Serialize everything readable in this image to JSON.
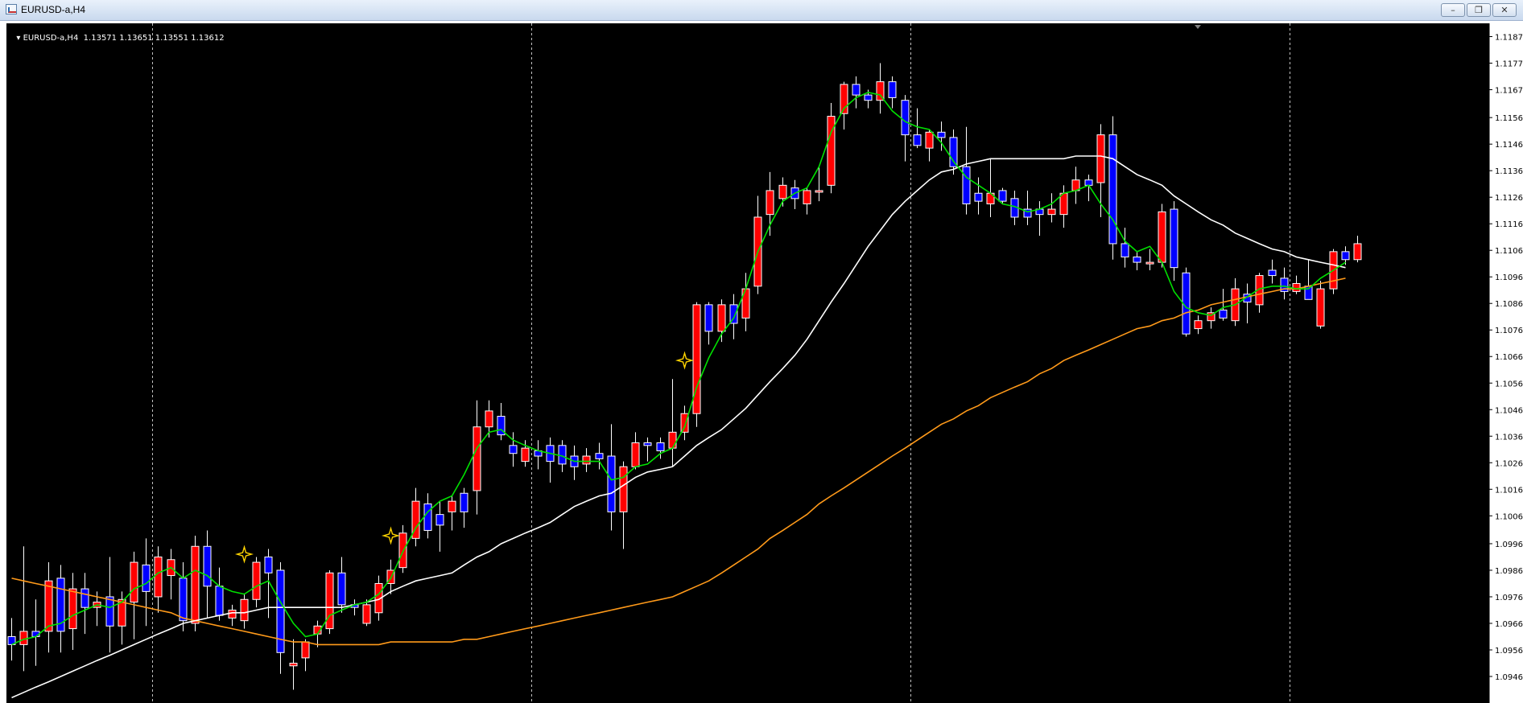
{
  "window": {
    "title": "EURUSD-a,H4",
    "minimize_icon": "minimize-icon",
    "restore_icon": "restore-icon",
    "close_icon": "close-icon"
  },
  "symbol_line": {
    "symbol": "EURUSD-a,H4",
    "ohlc": "1.13571 1.13651 1.13551 1.13612"
  },
  "colors": {
    "background": "#000000",
    "bull": "#ff0000",
    "bear": "#0000ff",
    "ma_fast": "#00e000",
    "ma_mid": "#ffffff",
    "ma_slow": "#ff9a1a",
    "fractal": "#ffd400",
    "grid": "#c0c0c0"
  },
  "chart_data": {
    "type": "candlestick",
    "ylim": [
      1.0936,
      1.1192
    ],
    "yticks": [
      "1.11870",
      "1.11770",
      "1.11670",
      "1.11565",
      "1.11465",
      "1.11365",
      "1.11265",
      "1.11165",
      "1.11065",
      "1.10965",
      "1.10865",
      "1.10765",
      "1.10665",
      "1.10565",
      "1.10465",
      "1.10365",
      "1.10265",
      "1.10165",
      "1.10065",
      "1.09960",
      "1.09860",
      "1.09760",
      "1.09660",
      "1.09560",
      "1.09460"
    ],
    "candles": [
      [
        1.0961,
        1.0968,
        1.0952,
        1.0958
      ],
      [
        1.0958,
        1.0995,
        1.0948,
        1.0963
      ],
      [
        1.0963,
        1.0975,
        1.095,
        1.0961
      ],
      [
        1.0963,
        1.0989,
        1.0955,
        1.0982
      ],
      [
        1.0983,
        1.0988,
        1.0955,
        1.0963
      ],
      [
        1.0964,
        1.0985,
        1.0956,
        1.0979
      ],
      [
        1.0979,
        1.0985,
        1.0962,
        1.0972
      ],
      [
        1.0972,
        1.0978,
        1.0965,
        1.0974
      ],
      [
        1.0976,
        1.0991,
        1.0955,
        1.0965
      ],
      [
        1.0965,
        1.0978,
        1.0958,
        1.0975
      ],
      [
        1.0974,
        1.0993,
        1.096,
        1.0989
      ],
      [
        1.0988,
        1.0998,
        1.0965,
        1.0978
      ],
      [
        1.0976,
        1.0995,
        1.097,
        1.0991
      ],
      [
        1.0984,
        1.0994,
        1.0975,
        1.099
      ],
      [
        1.0983,
        1.0989,
        1.0963,
        1.0967
      ],
      [
        1.0966,
        1.0999,
        1.0963,
        1.0995
      ],
      [
        1.0995,
        1.1001,
        1.0968,
        1.098
      ],
      [
        1.098,
        1.0987,
        1.0967,
        1.0969
      ],
      [
        1.0968,
        1.0973,
        1.0965,
        1.0971
      ],
      [
        1.0967,
        1.0977,
        1.0964,
        1.0975
      ],
      [
        1.0975,
        1.0991,
        1.0972,
        1.0989
      ],
      [
        1.0991,
        1.0994,
        1.0968,
        1.0985
      ],
      [
        1.0986,
        1.0989,
        1.0947,
        1.0955
      ],
      [
        1.095,
        1.096,
        1.0941,
        1.0951
      ],
      [
        1.0953,
        1.096,
        1.0948,
        1.0959
      ],
      [
        1.0962,
        1.0967,
        1.0957,
        1.0965
      ],
      [
        1.0964,
        1.0986,
        1.0962,
        1.0985
      ],
      [
        1.0985,
        1.0991,
        1.097,
        1.0973
      ],
      [
        1.0973,
        1.0975,
        1.0969,
        1.0972
      ],
      [
        1.0966,
        1.0975,
        1.0965,
        1.0973
      ],
      [
        1.097,
        1.0984,
        1.0967,
        1.0981
      ],
      [
        1.0981,
        1.099,
        1.0977,
        1.0986
      ],
      [
        1.0987,
        1.1003,
        1.0985,
        1.1
      ],
      [
        1.0998,
        1.1017,
        1.0995,
        1.1012
      ],
      [
        1.1011,
        1.1015,
        1.0998,
        1.1001
      ],
      [
        1.1007,
        1.1012,
        1.0993,
        1.1003
      ],
      [
        1.1008,
        1.1014,
        1.1001,
        1.1012
      ],
      [
        1.1015,
        1.1017,
        1.1002,
        1.1008
      ],
      [
        1.1016,
        1.105,
        1.1007,
        1.104
      ],
      [
        1.104,
        1.105,
        1.1036,
        1.1046
      ],
      [
        1.1044,
        1.1049,
        1.1035,
        1.1037
      ],
      [
        1.1033,
        1.1038,
        1.1025,
        1.103
      ],
      [
        1.1027,
        1.1035,
        1.1025,
        1.1032
      ],
      [
        1.1031,
        1.1035,
        1.1024,
        1.1029
      ],
      [
        1.1033,
        1.1036,
        1.1019,
        1.1027
      ],
      [
        1.1033,
        1.1035,
        1.1023,
        1.1026
      ],
      [
        1.1029,
        1.1033,
        1.102,
        1.1025
      ],
      [
        1.1026,
        1.1032,
        1.1023,
        1.1029
      ],
      [
        1.103,
        1.1034,
        1.1024,
        1.1028
      ],
      [
        1.1029,
        1.1041,
        1.1001,
        1.1008
      ],
      [
        1.1008,
        1.1027,
        1.0994,
        1.1025
      ],
      [
        1.1025,
        1.1038,
        1.1024,
        1.1034
      ],
      [
        1.1034,
        1.1036,
        1.1027,
        1.1033
      ],
      [
        1.1034,
        1.1036,
        1.1028,
        1.1031
      ],
      [
        1.1032,
        1.1058,
        1.1025,
        1.1038
      ],
      [
        1.1038,
        1.1048,
        1.1035,
        1.1045
      ],
      [
        1.1045,
        1.1087,
        1.104,
        1.1086
      ],
      [
        1.1086,
        1.1087,
        1.1071,
        1.1076
      ],
      [
        1.1076,
        1.1088,
        1.1072,
        1.1086
      ],
      [
        1.1086,
        1.109,
        1.1073,
        1.1079
      ],
      [
        1.1081,
        1.1098,
        1.1076,
        1.1092
      ],
      [
        1.1093,
        1.1127,
        1.109,
        1.1119
      ],
      [
        1.112,
        1.1136,
        1.1112,
        1.1129
      ],
      [
        1.1126,
        1.1134,
        1.1123,
        1.1131
      ],
      [
        1.113,
        1.1133,
        1.1122,
        1.1126
      ],
      [
        1.1124,
        1.113,
        1.112,
        1.1129
      ],
      [
        1.1129,
        1.1138,
        1.1125,
        1.1129
      ],
      [
        1.1131,
        1.1162,
        1.1128,
        1.1157
      ],
      [
        1.1158,
        1.117,
        1.1152,
        1.1169
      ],
      [
        1.1169,
        1.1172,
        1.116,
        1.1165
      ],
      [
        1.1165,
        1.1167,
        1.116,
        1.1163
      ],
      [
        1.1163,
        1.1177,
        1.1158,
        1.117
      ],
      [
        1.117,
        1.1172,
        1.116,
        1.1164
      ],
      [
        1.1163,
        1.1165,
        1.114,
        1.115
      ],
      [
        1.115,
        1.116,
        1.1145,
        1.1146
      ],
      [
        1.1145,
        1.1152,
        1.114,
        1.1151
      ],
      [
        1.1151,
        1.1155,
        1.1144,
        1.1149
      ],
      [
        1.1149,
        1.1152,
        1.1135,
        1.1138
      ],
      [
        1.1138,
        1.1153,
        1.112,
        1.1124
      ],
      [
        1.1128,
        1.1134,
        1.112,
        1.1125
      ],
      [
        1.1124,
        1.1141,
        1.1119,
        1.1128
      ],
      [
        1.1129,
        1.113,
        1.1124,
        1.1125
      ],
      [
        1.1126,
        1.1129,
        1.1116,
        1.1119
      ],
      [
        1.1122,
        1.1129,
        1.1116,
        1.1119
      ],
      [
        1.1122,
        1.1125,
        1.1112,
        1.112
      ],
      [
        1.112,
        1.1128,
        1.1117,
        1.1122
      ],
      [
        1.112,
        1.1131,
        1.1115,
        1.1128
      ],
      [
        1.1129,
        1.1138,
        1.1124,
        1.1133
      ],
      [
        1.1133,
        1.1135,
        1.1125,
        1.1131
      ],
      [
        1.1132,
        1.1154,
        1.1119,
        1.115
      ],
      [
        1.115,
        1.1157,
        1.1103,
        1.1109
      ],
      [
        1.1109,
        1.1115,
        1.11,
        1.1104
      ],
      [
        1.1104,
        1.1106,
        1.1099,
        1.1102
      ],
      [
        1.1102,
        1.1107,
        1.1099,
        1.1102
      ],
      [
        1.1102,
        1.1124,
        1.11,
        1.1121
      ],
      [
        1.1122,
        1.1125,
        1.1095,
        1.11
      ],
      [
        1.1098,
        1.11,
        1.1074,
        1.1075
      ],
      [
        1.1077,
        1.1082,
        1.1075,
        1.108
      ],
      [
        1.108,
        1.1085,
        1.1077,
        1.1083
      ],
      [
        1.1084,
        1.1092,
        1.108,
        1.1081
      ],
      [
        1.108,
        1.1096,
        1.1078,
        1.1092
      ],
      [
        1.109,
        1.1094,
        1.1079,
        1.1087
      ],
      [
        1.1086,
        1.1098,
        1.1083,
        1.1097
      ],
      [
        1.1099,
        1.1103,
        1.1094,
        1.1097
      ],
      [
        1.1096,
        1.11,
        1.1088,
        1.1091
      ],
      [
        1.1091,
        1.1097,
        1.109,
        1.1094
      ],
      [
        1.1093,
        1.1103,
        1.1088,
        1.1088
      ],
      [
        1.1078,
        1.1095,
        1.1077,
        1.1092
      ],
      [
        1.1092,
        1.1107,
        1.109,
        1.1106
      ],
      [
        1.1106,
        1.1108,
        1.1101,
        1.1103
      ],
      [
        1.1103,
        1.1112,
        1.1102,
        1.1109
      ]
    ],
    "ma_fast": [
      1.0958,
      1.096,
      1.0961,
      1.0965,
      1.0966,
      1.0969,
      1.0971,
      1.0973,
      1.0972,
      1.0974,
      1.0979,
      1.0981,
      1.0985,
      1.0987,
      1.0983,
      1.0986,
      1.0984,
      1.098,
      1.0978,
      1.0977,
      1.098,
      1.0982,
      1.0974,
      1.0966,
      1.0961,
      1.0962,
      1.0969,
      1.0971,
      1.0973,
      1.0974,
      1.0977,
      1.0983,
      1.0993,
      1.1002,
      1.1008,
      1.1012,
      1.1014,
      1.1022,
      1.1032,
      1.1038,
      1.1039,
      1.1035,
      1.1033,
      1.1031,
      1.103,
      1.1029,
      1.1027,
      1.1027,
      1.1027,
      1.102,
      1.1021,
      1.1025,
      1.1026,
      1.103,
      1.1032,
      1.104,
      1.1055,
      1.1066,
      1.1075,
      1.1081,
      1.1092,
      1.1106,
      1.1116,
      1.1125,
      1.1128,
      1.113,
      1.1138,
      1.1151,
      1.116,
      1.1164,
      1.1166,
      1.1165,
      1.1159,
      1.1155,
      1.1153,
      1.1152,
      1.1147,
      1.114,
      1.1134,
      1.1131,
      1.1128,
      1.1124,
      1.1123,
      1.1121,
      1.1122,
      1.1124,
      1.1128,
      1.1129,
      1.1131,
      1.1124,
      1.1118,
      1.111,
      1.1106,
      1.1108,
      1.1102,
      1.1091,
      1.1085,
      1.1083,
      1.1082,
      1.1085,
      1.1086,
      1.1089,
      1.1092,
      1.1093,
      1.1093,
      1.1092,
      1.1092,
      1.1096,
      1.1099,
      1.1102
    ],
    "ma_mid": [
      1.0938,
      1.094,
      1.0942,
      1.0944,
      1.0946,
      1.0948,
      1.095,
      1.0952,
      1.0954,
      1.0956,
      1.0958,
      1.096,
      1.0962,
      1.0964,
      1.0966,
      1.0967,
      1.0968,
      1.0969,
      1.097,
      1.097,
      1.0971,
      1.0972,
      1.0972,
      1.0972,
      1.0972,
      1.0972,
      1.0972,
      1.0972,
      1.0973,
      1.0974,
      1.0975,
      1.0978,
      1.098,
      1.0982,
      1.0983,
      1.0984,
      1.0985,
      1.0988,
      1.0991,
      1.0993,
      1.0996,
      1.0998,
      1.1,
      1.1002,
      1.1004,
      1.1007,
      1.101,
      1.1012,
      1.1014,
      1.1015,
      1.1018,
      1.1021,
      1.1023,
      1.1024,
      1.1025,
      1.1029,
      1.1033,
      1.1036,
      1.1039,
      1.1043,
      1.1047,
      1.1052,
      1.1057,
      1.1062,
      1.1067,
      1.1073,
      1.108,
      1.1087,
      1.1094,
      1.1101,
      1.1108,
      1.1114,
      1.112,
      1.1125,
      1.1129,
      1.1133,
      1.1136,
      1.1137,
      1.1139,
      1.114,
      1.1141,
      1.1141,
      1.1141,
      1.1141,
      1.1141,
      1.1141,
      1.1141,
      1.1142,
      1.1142,
      1.1142,
      1.1141,
      1.1138,
      1.1135,
      1.1133,
      1.1131,
      1.1127,
      1.1124,
      1.1121,
      1.1118,
      1.1116,
      1.1113,
      1.1111,
      1.1109,
      1.1107,
      1.1106,
      1.1104,
      1.1103,
      1.1102,
      1.1101,
      1.11
    ],
    "ma_slow": [
      1.0983,
      1.0982,
      1.0981,
      1.098,
      1.0979,
      1.0978,
      1.0977,
      1.0976,
      1.0975,
      1.0974,
      1.0973,
      1.0972,
      1.0971,
      1.097,
      1.0968,
      1.0967,
      1.0966,
      1.0965,
      1.0964,
      1.0963,
      1.0962,
      1.0961,
      1.096,
      1.0959,
      1.0959,
      1.0958,
      1.0958,
      1.0958,
      1.0958,
      1.0958,
      1.0958,
      1.0959,
      1.0959,
      1.0959,
      1.0959,
      1.0959,
      1.0959,
      1.096,
      1.096,
      1.0961,
      1.0962,
      1.0963,
      1.0964,
      1.0965,
      1.0966,
      1.0967,
      1.0968,
      1.0969,
      1.097,
      1.0971,
      1.0972,
      1.0973,
      1.0974,
      1.0975,
      1.0976,
      1.0978,
      1.098,
      1.0982,
      1.0985,
      1.0988,
      1.0991,
      1.0994,
      1.0998,
      1.1001,
      1.1004,
      1.1007,
      1.1011,
      1.1014,
      1.1017,
      1.102,
      1.1023,
      1.1026,
      1.1029,
      1.1032,
      1.1035,
      1.1038,
      1.1041,
      1.1043,
      1.1046,
      1.1048,
      1.1051,
      1.1053,
      1.1055,
      1.1057,
      1.106,
      1.1062,
      1.1065,
      1.1067,
      1.1069,
      1.1071,
      1.1073,
      1.1075,
      1.1077,
      1.1078,
      1.108,
      1.1081,
      1.1083,
      1.1084,
      1.1086,
      1.1087,
      1.1088,
      1.1089,
      1.109,
      1.1091,
      1.1092,
      1.1092,
      1.1093,
      1.1094,
      1.1095,
      1.1096
    ],
    "fractals": [
      [
        19,
        1.0989
      ],
      [
        31,
        1.0996
      ],
      [
        55,
        1.1062
      ]
    ],
    "session_separators": [
      11,
      42,
      73,
      104
    ]
  }
}
